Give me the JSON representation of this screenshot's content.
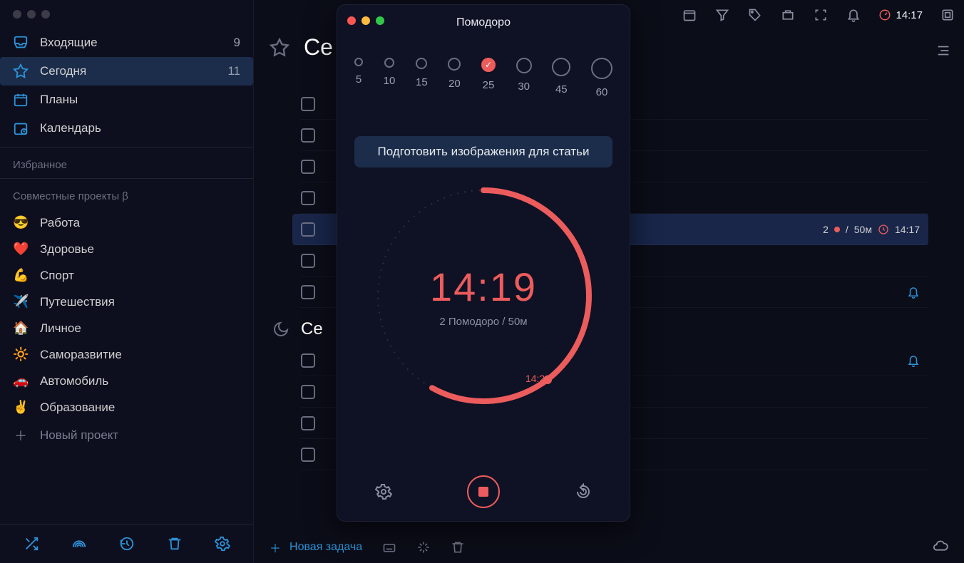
{
  "colors": {
    "accent": "#ec5c5c",
    "link": "#2d93d8"
  },
  "topbar": {
    "time": "14:17"
  },
  "sidebar": {
    "smart": [
      {
        "icon": "inbox",
        "label": "Входящие",
        "count": "9"
      },
      {
        "icon": "star",
        "label": "Сегодня",
        "count": "11",
        "active": true
      },
      {
        "icon": "plans",
        "label": "Планы",
        "count": ""
      },
      {
        "icon": "calendar",
        "label": "Календарь",
        "count": ""
      }
    ],
    "favorites_heading": "Избранное",
    "shared_heading": "Совместные проекты β",
    "projects": [
      {
        "emoji": "😎",
        "label": "Работа"
      },
      {
        "emoji": "❤️",
        "label": "Здоровье"
      },
      {
        "emoji": "💪",
        "label": "Спорт"
      },
      {
        "emoji": "✈️",
        "label": "Путешествия"
      },
      {
        "emoji": "🏠",
        "label": "Личное"
      },
      {
        "emoji": "🔆",
        "label": "Саморазвитие"
      },
      {
        "emoji": "🚗",
        "label": "Автомобиль"
      },
      {
        "emoji": "✌️",
        "label": "Образование"
      }
    ],
    "new_project": "Новый проект"
  },
  "main": {
    "title_trunc": "Се",
    "section2_trunc": "Се",
    "new_task": "Новая задача",
    "selected_task": {
      "pomo_done": "2",
      "pomo_total": "50м",
      "due": "14:17"
    }
  },
  "pomodoro": {
    "title": "Помодоро",
    "durations": [
      {
        "label": "5",
        "size": 12
      },
      {
        "label": "10",
        "size": 14
      },
      {
        "label": "15",
        "size": 16
      },
      {
        "label": "20",
        "size": 18
      },
      {
        "label": "25",
        "size": 20,
        "selected": true
      },
      {
        "label": "30",
        "size": 22
      },
      {
        "label": "45",
        "size": 26
      },
      {
        "label": "60",
        "size": 30
      }
    ],
    "task": "Подготовить изображения для статьи",
    "time": "14:19",
    "sub": "2 Помодоро / 50м",
    "end_at": "14:22"
  }
}
